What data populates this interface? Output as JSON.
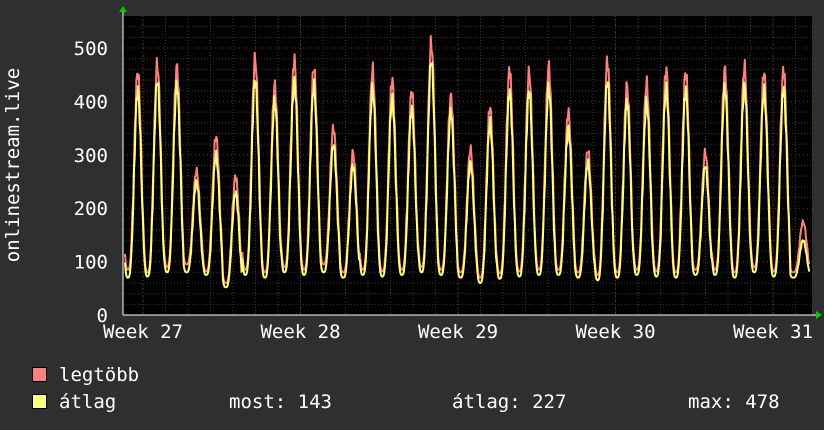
{
  "chart_data": {
    "type": "line",
    "ylabel": "onlinestream.live",
    "ylim": [
      0,
      560
    ],
    "yticks": [
      0,
      100,
      200,
      300,
      400,
      500
    ],
    "xlabels": [
      "Week 27",
      "Week 28",
      "Week 29",
      "Week 30",
      "Week 31"
    ],
    "grid": true,
    "x_unit": "day",
    "x_start_day": 0,
    "days": 35,
    "series": [
      {
        "name": "legtöbb",
        "color": "#ff7f7f",
        "daily": [
          {
            "min": 85,
            "max": 455
          },
          {
            "min": 80,
            "max": 470
          },
          {
            "min": 90,
            "max": 465
          },
          {
            "min": 95,
            "max": 270
          },
          {
            "min": 82,
            "max": 335
          },
          {
            "min": 60,
            "max": 260
          },
          {
            "min": 85,
            "max": 480
          },
          {
            "min": 80,
            "max": 430
          },
          {
            "min": 90,
            "max": 478
          },
          {
            "min": 85,
            "max": 465
          },
          {
            "min": 95,
            "max": 350
          },
          {
            "min": 80,
            "max": 305
          },
          {
            "min": 85,
            "max": 460
          },
          {
            "min": 82,
            "max": 440
          },
          {
            "min": 85,
            "max": 420
          },
          {
            "min": 90,
            "max": 510
          },
          {
            "min": 85,
            "max": 410
          },
          {
            "min": 80,
            "max": 310
          },
          {
            "min": 70,
            "max": 390
          },
          {
            "min": 78,
            "max": 460
          },
          {
            "min": 82,
            "max": 455
          },
          {
            "min": 85,
            "max": 465
          },
          {
            "min": 85,
            "max": 380
          },
          {
            "min": 80,
            "max": 310
          },
          {
            "min": 75,
            "max": 475
          },
          {
            "min": 80,
            "max": 430
          },
          {
            "min": 85,
            "max": 435
          },
          {
            "min": 82,
            "max": 460
          },
          {
            "min": 80,
            "max": 455
          },
          {
            "min": 85,
            "max": 305
          },
          {
            "min": 85,
            "max": 460
          },
          {
            "min": 80,
            "max": 465
          },
          {
            "min": 90,
            "max": 455
          },
          {
            "min": 82,
            "max": 460
          },
          {
            "min": 80,
            "max": 175
          }
        ]
      },
      {
        "name": "átlag",
        "color": "#ffff7f",
        "daily": [
          {
            "min": 70,
            "max": 420
          },
          {
            "min": 72,
            "max": 440
          },
          {
            "min": 80,
            "max": 430
          },
          {
            "min": 80,
            "max": 250
          },
          {
            "min": 75,
            "max": 300
          },
          {
            "min": 52,
            "max": 230
          },
          {
            "min": 75,
            "max": 440
          },
          {
            "min": 70,
            "max": 400
          },
          {
            "min": 80,
            "max": 440
          },
          {
            "min": 75,
            "max": 430
          },
          {
            "min": 80,
            "max": 320
          },
          {
            "min": 70,
            "max": 280
          },
          {
            "min": 75,
            "max": 425
          },
          {
            "min": 72,
            "max": 405
          },
          {
            "min": 75,
            "max": 385
          },
          {
            "min": 80,
            "max": 478
          },
          {
            "min": 75,
            "max": 380
          },
          {
            "min": 70,
            "max": 285
          },
          {
            "min": 60,
            "max": 360
          },
          {
            "min": 68,
            "max": 420
          },
          {
            "min": 72,
            "max": 420
          },
          {
            "min": 75,
            "max": 425
          },
          {
            "min": 75,
            "max": 350
          },
          {
            "min": 70,
            "max": 285
          },
          {
            "min": 65,
            "max": 440
          },
          {
            "min": 70,
            "max": 400
          },
          {
            "min": 75,
            "max": 400
          },
          {
            "min": 72,
            "max": 425
          },
          {
            "min": 70,
            "max": 420
          },
          {
            "min": 75,
            "max": 280
          },
          {
            "min": 75,
            "max": 425
          },
          {
            "min": 70,
            "max": 430
          },
          {
            "min": 80,
            "max": 420
          },
          {
            "min": 72,
            "max": 425
          },
          {
            "min": 70,
            "max": 140
          }
        ]
      }
    ]
  },
  "legend": {
    "max_label": "legtöbb",
    "avg_label": "átlag",
    "max_color": "#ff7f7f",
    "avg_color": "#ffff7f"
  },
  "stats": {
    "now": "most: 143",
    "avg": "átlag: 227",
    "max": "max: 478"
  }
}
